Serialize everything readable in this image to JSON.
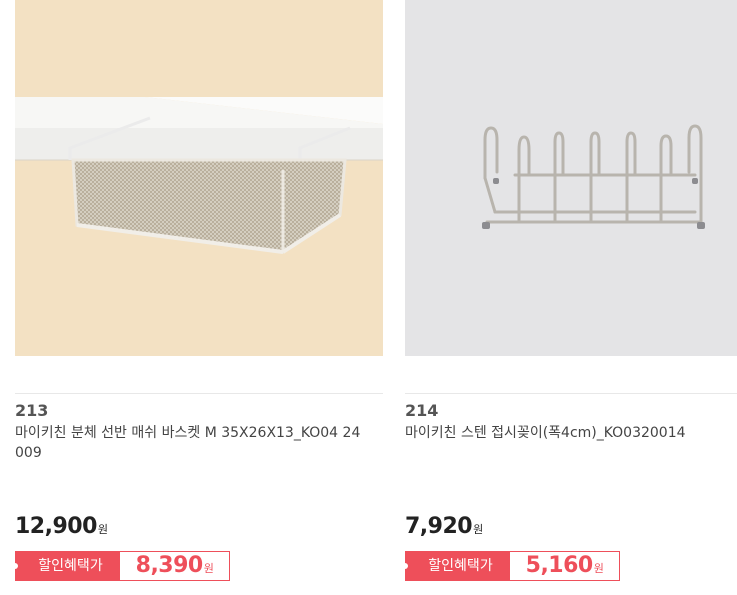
{
  "products": [
    {
      "number": "213",
      "name": "마이키친 분체 선반 매쉬 바스켓 M 35X26X13_KO04 24009",
      "price": "12,900",
      "price_unit": "원",
      "discount_label": "할인혜택가",
      "discount_price": "8,390",
      "discount_unit": "원"
    },
    {
      "number": "214",
      "name": "마이키친 스텐 접시꽂이(폭4cm)_KO0320014",
      "price": "7,920",
      "price_unit": "원",
      "discount_label": "할인혜택가",
      "discount_price": "5,160",
      "discount_unit": "원"
    }
  ],
  "colors": {
    "discount_accent": "#ee4f5a",
    "image1_background": "#f4e2c4",
    "image2_background": "#e3e3e5"
  }
}
